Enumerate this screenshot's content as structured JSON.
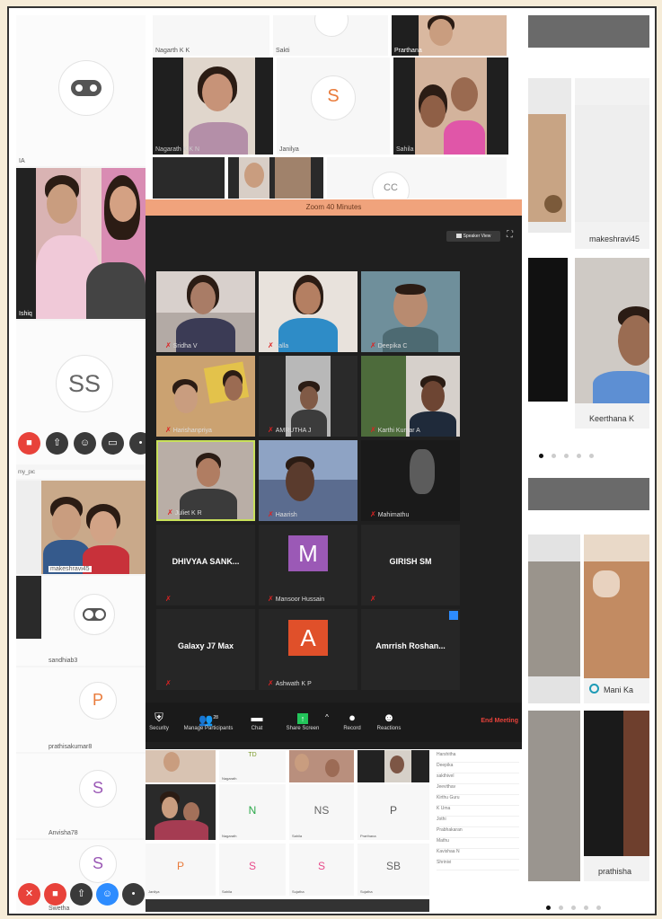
{
  "colors": {
    "page_bg": "#f6ecd8",
    "zoom_dark": "#1f1f1f",
    "zoom_header": "#f0a37c",
    "end_meeting": "#e8423a",
    "avatar_orange": "#e97b3b",
    "avatar_purple": "#9b59b6",
    "avatar_gray": "#666666"
  },
  "left_col": {
    "label_a": "IA",
    "label_b": "Ishiq",
    "ss_initials": "SS",
    "top_strip": "my_pic",
    "tiles": [
      {
        "name": "makeshravi45",
        "initial": ""
      },
      {
        "name": "sandhiab3",
        "initial": ""
      },
      {
        "name": "prathisakumar8",
        "initial": "P"
      },
      {
        "name": "Anvisha78",
        "initial": "S"
      },
      {
        "name": "Swetha",
        "initial": "S"
      }
    ]
  },
  "top_grid": {
    "labels": [
      "Nagarth K K",
      "Sakti",
      "Prarthana",
      "Nagarath K K N",
      "Janilya",
      "Sahila"
    ],
    "initial_s": "S",
    "partial": "CC"
  },
  "zoom": {
    "header": "Zoom 40 Minutes",
    "speaker_view": "Speaker View",
    "participants": [
      {
        "name": "Sridha V",
        "kind": "video"
      },
      {
        "name": "Jalla",
        "kind": "video"
      },
      {
        "name": "Deepika C",
        "kind": "video"
      },
      {
        "name": "Harishanpriya",
        "kind": "video"
      },
      {
        "name": "AMRUTHA J",
        "kind": "video"
      },
      {
        "name": "Karthi Kumar A",
        "kind": "video"
      },
      {
        "name": "Juliet K R",
        "kind": "video"
      },
      {
        "name": "Haarish",
        "kind": "video"
      },
      {
        "name": "Mahimathu",
        "kind": "video"
      },
      {
        "name": "DHIVYAA SANK...",
        "kind": "name",
        "footer": ""
      },
      {
        "name": "Mansoor Hussain",
        "kind": "avatar",
        "initial": "M"
      },
      {
        "name": "GIRISH SM",
        "kind": "name",
        "footer": ""
      },
      {
        "name": "Galaxy J7 Max",
        "kind": "name",
        "footer": ""
      },
      {
        "name": "Ashwath K P",
        "kind": "avatar",
        "initial": "A"
      },
      {
        "name": "Amrrish Roshan...",
        "kind": "name",
        "footer": ""
      }
    ],
    "toolbar": {
      "security": "Security",
      "participants": "Manage Participants",
      "participant_count": "28",
      "chat": "Chat",
      "share": "Share Screen",
      "record": "Record",
      "reactions": "Reactions",
      "end": "End Meeting"
    }
  },
  "bottom_grid": {
    "top_label": "TD",
    "initials": [
      "N",
      "NS",
      "P",
      "P",
      "S",
      "S",
      "SB"
    ],
    "labels": [
      "Nagarath",
      "Nagarath",
      "Sahila",
      "Prarthana",
      "Janilya",
      "Sahila",
      "Sujatha",
      "Sujatha",
      "Sahila"
    ],
    "participants_list": [
      "Harshitha",
      "Deepika",
      "sakthivel",
      "Jeevithav",
      "Kirthu Guru",
      "K Uma",
      "Jothi",
      "Prabhakaran",
      "Mathu",
      "Kavishaa N",
      "Shrinivi"
    ]
  },
  "right_col": {
    "name_1": "makeshravi45",
    "name_2": "Keerthana K",
    "name_3": "Mani Ka",
    "name_4": "prathisha"
  }
}
